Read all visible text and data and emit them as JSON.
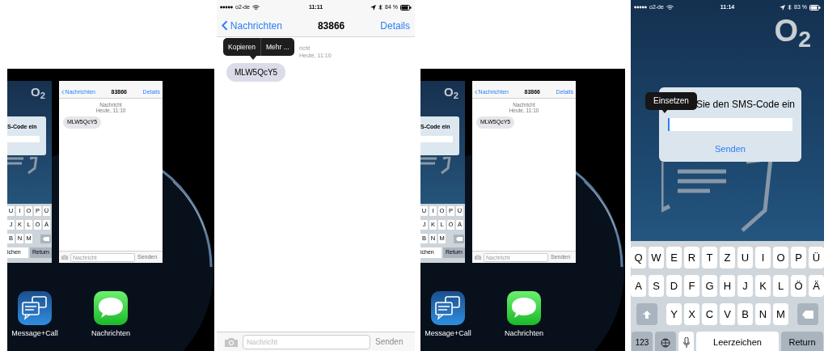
{
  "panels": [
    {
      "kind": "switcher",
      "back_app": {
        "logo": "O$_{2}$",
        "dialog_title": "S-Code ein",
        "key_rows": [
          [
            "U",
            "I",
            "O",
            "P",
            "Ü"
          ],
          [
            "J",
            "K",
            "L",
            "Ö",
            "Ä"
          ],
          [
            "B",
            "N",
            "M"
          ]
        ],
        "space": "ichen",
        "return": "Return"
      },
      "card": {
        "back": "Nachrichten",
        "title": "83866",
        "details": "Details",
        "meta": "Nachricht",
        "date": "Heute, 11:10",
        "bubble": "MLW5QcY5",
        "placeholder": "Nachricht",
        "send": "Senden"
      },
      "apps": [
        {
          "kind": "message_call",
          "name": "Message+Call"
        },
        {
          "kind": "messages",
          "name": "Nachrichten"
        }
      ]
    },
    {
      "kind": "conversation",
      "status": {
        "carrier": "o2-de",
        "time": "11:11",
        "battery": "84 %"
      },
      "nav": {
        "back": "Nachrichten",
        "title": "83866",
        "details": "Details"
      },
      "menu": [
        {
          "label": "Kopieren"
        },
        {
          "label": "Mehr ..."
        }
      ],
      "meta": "richt",
      "date": "Heute, 11:10",
      "bubble": "MLW5QcY5",
      "composer": {
        "placeholder": "Nachricht",
        "send": "Senden"
      }
    },
    {
      "kind": "switcher",
      "back_app": {
        "logo": "O$_{2}$",
        "dialog_title": "S-Code ein",
        "key_rows": [
          [
            "U",
            "I",
            "O",
            "P",
            "Ü"
          ],
          [
            "J",
            "K",
            "L",
            "Ö",
            "Ä"
          ],
          [
            "B",
            "N",
            "M"
          ]
        ],
        "space": "ichen",
        "return": "Return"
      },
      "card": {
        "back": "Nachrichten",
        "title": "83866",
        "details": "Details",
        "meta": "Nachricht",
        "date": "Heute, 11:10",
        "bubble": "MLW5QcY5",
        "placeholder": "Nachricht",
        "send": "Senden"
      },
      "apps": [
        {
          "kind": "message_call",
          "name": "Message+Call"
        },
        {
          "kind": "messages",
          "name": "Nachrichten"
        }
      ]
    },
    {
      "kind": "sms_code",
      "status": {
        "carrier": "o2-de",
        "time": "11:14",
        "battery": "83 %"
      },
      "logo": "O$_{2}$",
      "tooltip": "Einsetzen",
      "dialog": {
        "title": "Sie den SMS-Code ein",
        "button": "Senden"
      },
      "keyboard": {
        "top_row": [
          "Q",
          "W",
          "E",
          "R",
          "T",
          "Z",
          "U",
          "I",
          "O",
          "P",
          "Ü"
        ],
        "middle_row": [
          "A",
          "S",
          "D",
          "F",
          "G",
          "H",
          "J",
          "K",
          "L",
          "Ö",
          "Ä"
        ],
        "bottom_row": [
          "Y",
          "X",
          "C",
          "V",
          "B",
          "N",
          "M"
        ],
        "numbers": "123",
        "space": "Leerzeichen",
        "return": "Return"
      }
    }
  ]
}
